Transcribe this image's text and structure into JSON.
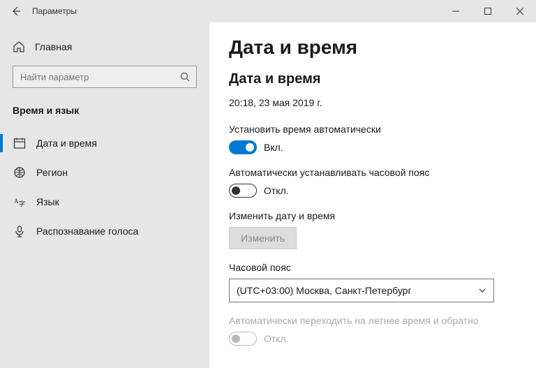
{
  "titlebar": {
    "title": "Параметры"
  },
  "sidebar": {
    "home_label": "Главная",
    "search_placeholder": "Найти параметр",
    "category": "Время и язык",
    "items": [
      {
        "label": "Дата и время"
      },
      {
        "label": "Регион"
      },
      {
        "label": "Язык"
      },
      {
        "label": "Распознавание голоса"
      }
    ]
  },
  "main": {
    "page_title": "Дата и время",
    "section_title": "Дата и время",
    "current_datetime": "20:18, 23 мая 2019 г.",
    "auto_time": {
      "label": "Установить время автоматически",
      "state_text": "Вкл."
    },
    "auto_tz": {
      "label": "Автоматически устанавливать часовой пояс",
      "state_text": "Откл."
    },
    "change_dt": {
      "label": "Изменить дату и время",
      "button": "Изменить"
    },
    "timezone": {
      "label": "Часовой пояс",
      "value": "(UTC+03:00) Москва, Санкт-Петербург"
    },
    "dst": {
      "label": "Автоматически переходить на летнее время и обратно",
      "state_text": "Откл."
    }
  }
}
